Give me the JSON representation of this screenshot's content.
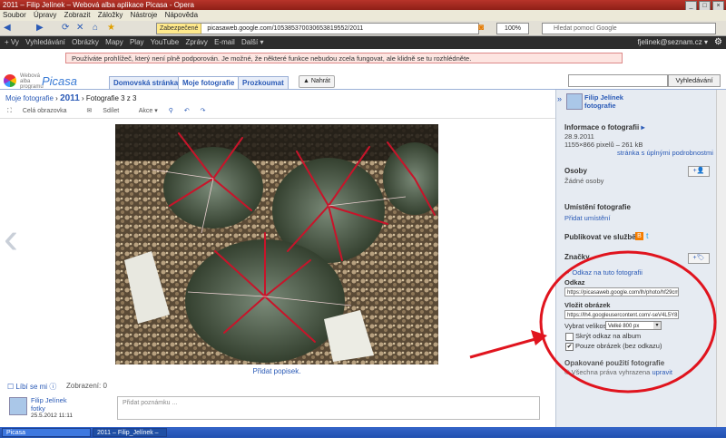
{
  "window": {
    "title": "2011 – Filip Jelínek – Webová alba aplikace Picasa - Opera"
  },
  "menubar": [
    "Soubor",
    "Úpravy",
    "Zobrazit",
    "Záložky",
    "Nástroje",
    "Nápověda"
  ],
  "navbar": {
    "secure_label": "Zabezpečené",
    "url": "picasaweb.google.com/105385370030653819552/2011",
    "zoom": "100%",
    "search_placeholder": "Hledat pomocí Google"
  },
  "googlebar": {
    "items": [
      "+ Vy",
      "Vyhledávání",
      "Obrázky",
      "Mapy",
      "Play",
      "YouTube",
      "Zprávy",
      "E-mail",
      "Další ▾"
    ],
    "account": "fjelinek@seznam.cz ▾"
  },
  "warning": "Používáte prohlížeč, který není plně podporován. Je možné, že některé funkce nebudou zcela fungovat, ale klidně se tu rozhlédněte.",
  "header": {
    "logo_small": "Webová alba programu",
    "logo_big": "Picasa",
    "tabs": [
      "Domovská stránka",
      "Moje fotografie",
      "Prozkoumat"
    ],
    "upload": "▲ Nahrát",
    "search_button": "Vyhledávání"
  },
  "breadcrumb": {
    "root": "Moje fotografie",
    "sep": "›",
    "album": "2011",
    "current": "› Fotografie 3 z 3"
  },
  "phototools": {
    "fullscreen": "Celá obrazovka",
    "share": "Sdílet",
    "actions": "Akce ▾"
  },
  "photo": {
    "caption_link": "Přidat popisek."
  },
  "bottom": {
    "like": "Líbí se mi",
    "views": "Zobrazení: 0",
    "user": "Filip Jelínek",
    "user_sub": "fotky",
    "date": "25.5.2012 11:11",
    "comment_placeholder": "Přidat poznámku ..."
  },
  "sidebar": {
    "owner_name": "Filip Jelínek",
    "owner_sub": "fotografie",
    "info_heading": "Informace o fotografii",
    "date": "28.9.2011",
    "size": "1155×866 pixelů – 261 kB",
    "exif_link": "stránka s úplnými podrobnostmi",
    "people_heading": "Osoby",
    "no_people": "Žádné osoby",
    "location_heading": "Umístění fotografie",
    "add_location": "Přidat umístění",
    "publish_heading": "Publikovat ve službě:",
    "tags_heading": "Značky",
    "link_to_photo": "Odkaz na tuto fotografii",
    "link_label": "Odkaz",
    "link_value": "https://picasaweb.google.com/lh/photo/hf29cm",
    "embed_label": "Vložit obrázek",
    "embed_value": "https://lh4.googleusercontent.com/-seV4L5Y8",
    "size_label": "Vybrat velikost",
    "size_value": "Velké 800 px",
    "hide_album_link": "Skrýt odkaz na album",
    "only_image": "Pouze obrázek (bez odkazu)",
    "reuse_heading": "Opakované použití fotografie",
    "rights": "Všechna práva vyhrazena",
    "edit": "upravit"
  },
  "taskbar": {
    "item1": "Picasa",
    "item2": "2011 – Filip_Jelínek – We..."
  },
  "colors": {
    "accent": "#2a5ab6",
    "annotation": "#e0141e",
    "sidebar_bg": "#e6ebf2"
  }
}
